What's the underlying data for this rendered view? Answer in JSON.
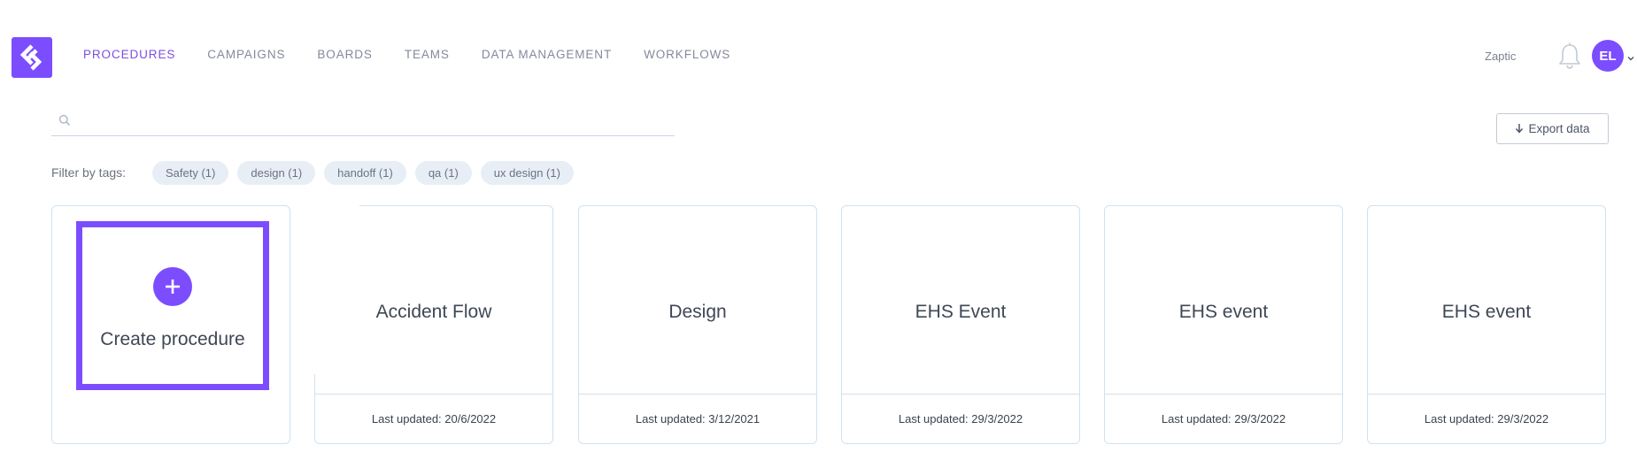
{
  "nav": {
    "items": [
      "PROCEDURES",
      "CAMPAIGNS",
      "BOARDS",
      "TEAMS",
      "DATA MANAGEMENT",
      "WORKFLOWS"
    ],
    "active": "PROCEDURES"
  },
  "header": {
    "brand": "Zaptic",
    "user_initials": "EL"
  },
  "search": {
    "value": "",
    "placeholder": ""
  },
  "toolbar": {
    "export_label": "Export data"
  },
  "filters": {
    "label": "Filter by tags:",
    "tags": [
      "Safety (1)",
      "design (1)",
      "handoff (1)",
      "qa (1)",
      "ux design (1)"
    ]
  },
  "create_card": {
    "label": "Create procedure"
  },
  "procedures": [
    {
      "title": "Accident Flow",
      "updated": "Last updated: 20/6/2022"
    },
    {
      "title": "Design",
      "updated": "Last updated: 3/12/2021"
    },
    {
      "title": "EHS Event",
      "updated": "Last updated: 29/3/2022"
    },
    {
      "title": "EHS event",
      "updated": "Last updated: 29/3/2022"
    },
    {
      "title": "EHS event",
      "updated": "Last updated: 29/3/2022"
    }
  ],
  "colors": {
    "accent": "#7c4dff",
    "nav_active": "#7a4fe3",
    "tag_bg": "#e8eef6",
    "card_border": "#cfe2f0"
  },
  "icons": {
    "logo": "zaptic-logo-icon",
    "search": "search-icon",
    "bell": "bell-icon",
    "caret": "chevron-down-icon",
    "export": "arrow-down-icon",
    "plus": "plus-icon"
  }
}
